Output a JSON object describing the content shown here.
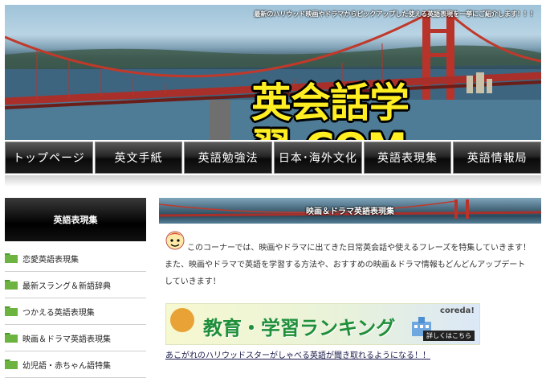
{
  "header": {
    "tagline": "最新のハリウッド映画やドラマからピックアップした使える英語表現を一挙にご紹介します！！！",
    "logo": "英会話学習.COM"
  },
  "nav": {
    "items": [
      "トップページ",
      "英文手紙",
      "英語勉強法",
      "日本･海外文化",
      "英語表現集",
      "英語情報局"
    ]
  },
  "sidebar": {
    "title": "英語表現集",
    "items": [
      {
        "label": "恋愛英語表現集"
      },
      {
        "label": "最新スラング＆新語辞典"
      },
      {
        "label": "つかえる英語表現集"
      },
      {
        "label": "映画＆ドラマ英語表現集"
      },
      {
        "label": "幼児語・赤ちゃん語特集"
      }
    ]
  },
  "main": {
    "section_title": "映画＆ドラマ英語表現集",
    "intro_line1": "このコーナーでは、映画やドラマに出てきた日常英会話や使えるフレーズを特集していきます！",
    "intro_line2": "また、映画やドラマで英語を学習する方法や、おすすめの映画＆ドラマ情報もどんどんアップデート",
    "intro_line3": "していきます！",
    "ranking_banner": {
      "title": "教育・学習ランキング",
      "brand": "coreda!",
      "more": "詳しくはこちら"
    },
    "link_text": "あこがれのハリウッドスターがしゃべる英語が聞き取れるようになる！！"
  },
  "colors": {
    "logo": "#ffef22",
    "bridge": "#c0392b",
    "folder": "#6db33f",
    "ranking_title": "#1f8f3a"
  }
}
